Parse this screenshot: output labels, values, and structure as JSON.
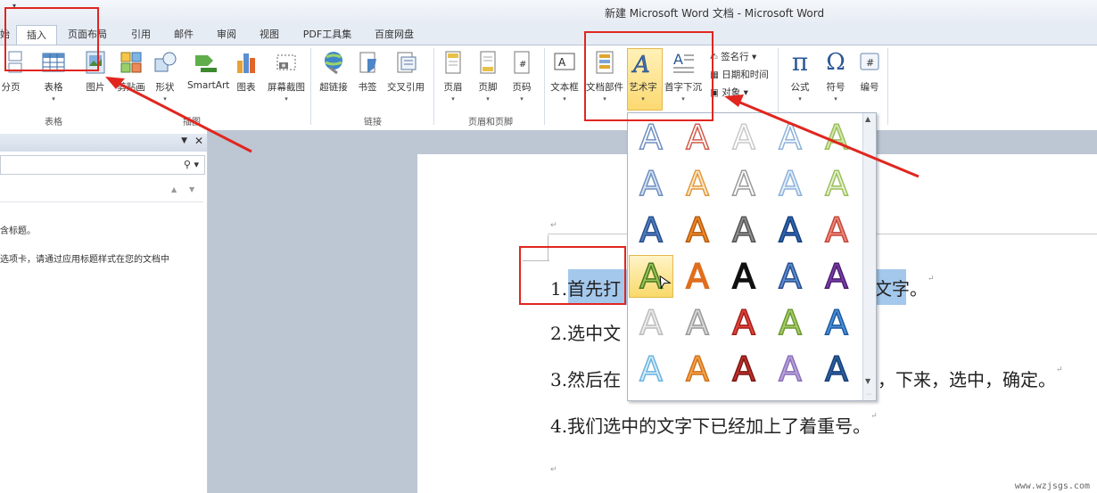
{
  "window": {
    "title": "新建 Microsoft Word 文档 - Microsoft Word"
  },
  "tabs": [
    "插入",
    "页面布局",
    "引用",
    "邮件",
    "审阅",
    "视图",
    "PDF工具集",
    "百度网盘"
  ],
  "ribbon": {
    "buttons": [
      "分页",
      "表格",
      "图片",
      "剪贴画",
      "形状",
      "SmartArt",
      "图表",
      "屏幕截图",
      "超链接",
      "书签",
      "交叉引用",
      "页眉",
      "页脚",
      "页码",
      "文本框",
      "文档部件",
      "艺术字",
      "首字下沉",
      "公式",
      "符号",
      "编号"
    ],
    "small_items": [
      "签名行",
      "日期和时间",
      "对象"
    ],
    "groups": [
      "表格",
      "插图",
      "链接",
      "页眉和页脚"
    ]
  },
  "pane": {
    "text1": "含标题。",
    "text2": "选项卡，请通过应用标题样式在您的文档中"
  },
  "document": {
    "line1_a": "1.首先打",
    "line1_b": "文字",
    "line1_c": "。",
    "line2": "2.选中文",
    "line3_a": "3.然后在",
    "line3_b": "，下来，选中，确定。",
    "line4": "4.我们选中的文字下已经加上了着重号。"
  },
  "watermark": "www.wzjsgs.com",
  "colors": {
    "accent": "#e0261f",
    "selection": "#a4c8ec",
    "wordart_highlight": "#fcd971"
  }
}
